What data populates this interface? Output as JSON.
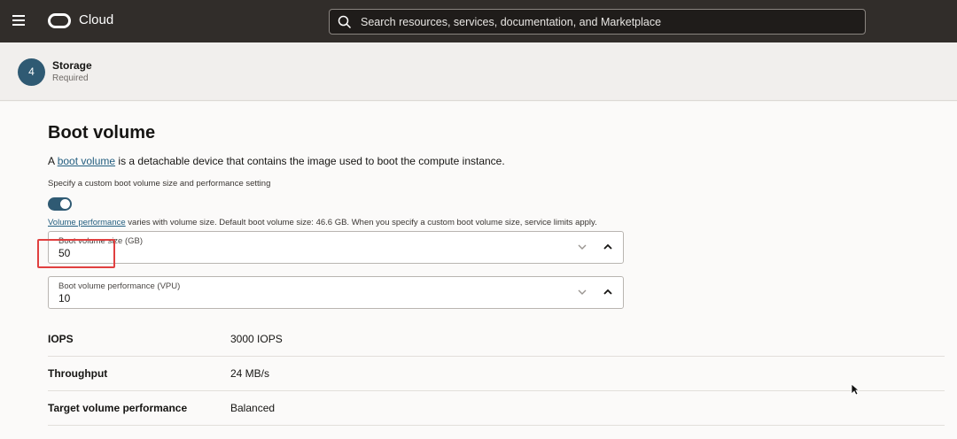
{
  "topbar": {
    "brand": "Cloud",
    "search_placeholder": "Search resources, services, documentation, and Marketplace"
  },
  "step": {
    "number": "4",
    "title": "Storage",
    "subtitle": "Required"
  },
  "boot_volume": {
    "title": "Boot volume",
    "desc_prefix": "A ",
    "desc_link": "boot volume",
    "desc_suffix": " is a detachable device that contains the image used to boot the compute instance.",
    "custom_label": "Specify a custom boot volume size and performance setting",
    "toggle_on": true,
    "perf_link": "Volume performance",
    "perf_note": " varies with volume size. Default boot volume size: 46.6 GB. When you specify a custom boot volume size, service limits apply.",
    "size_field": {
      "label": "Boot volume size (GB)",
      "value": "50"
    },
    "vpu_field": {
      "label": "Boot volume performance (VPU)",
      "value": "10"
    }
  },
  "metrics": [
    {
      "label": "IOPS",
      "value": "3000 IOPS"
    },
    {
      "label": "Throughput",
      "value": "24 MB/s"
    },
    {
      "label": "Target volume performance",
      "value": "Balanced"
    }
  ]
}
